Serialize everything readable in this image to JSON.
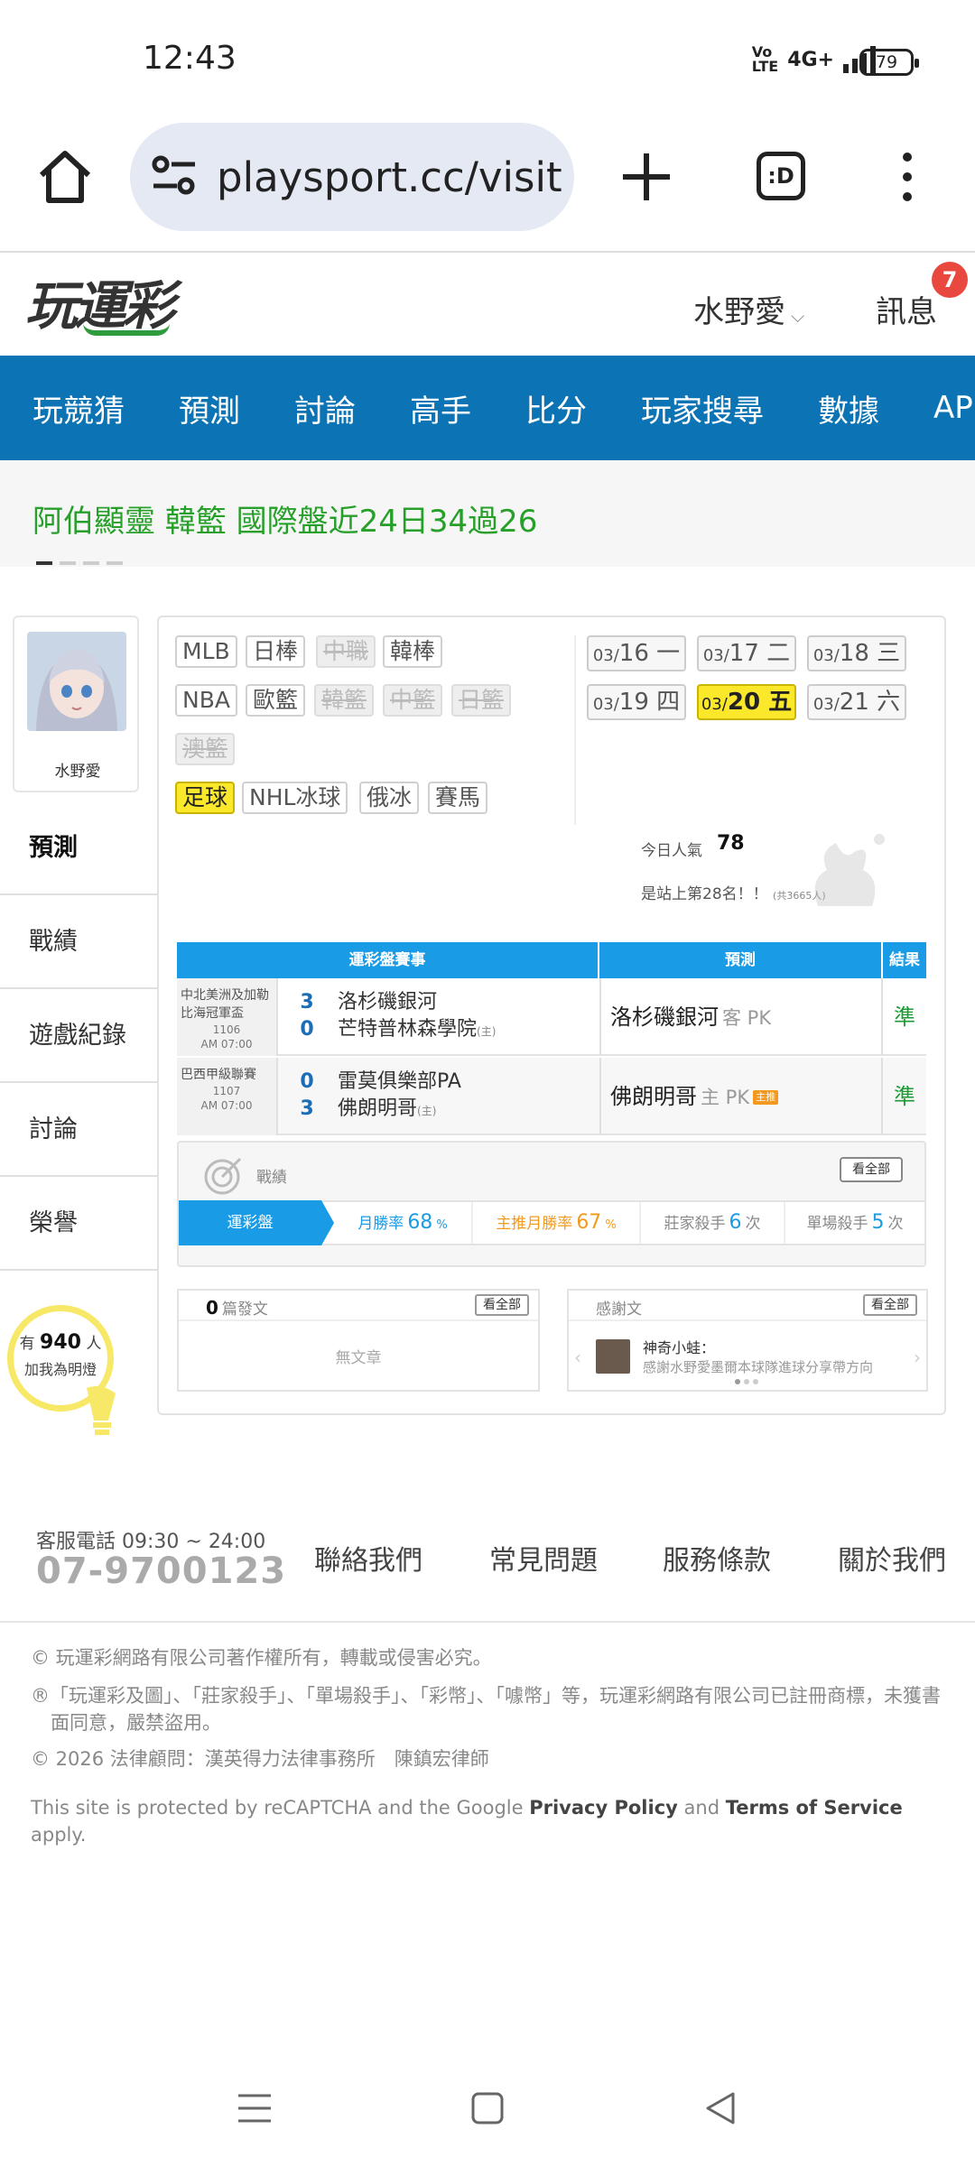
{
  "status": {
    "time": "12:43",
    "network": "4G+",
    "battery": "79"
  },
  "browser": {
    "url": "playsport.cc/visit",
    "tabs_label": ":D"
  },
  "header": {
    "logo": "玩運彩",
    "user": "水野愛",
    "messages_label": "訊息",
    "messages_count": "7"
  },
  "nav": [
    "玩競猜",
    "預測",
    "討論",
    "高手",
    "比分",
    "玩家搜尋",
    "數據",
    "APP"
  ],
  "ticker": {
    "text": "阿伯顯靈 韓籃 國際盤近24日34過26"
  },
  "profile": {
    "name": "水野愛"
  },
  "sidemenu": [
    "預測",
    "戰績",
    "遊戲紀錄",
    "討論",
    "榮譽"
  ],
  "fans": {
    "prefix": "有",
    "count": "940",
    "suffix": "人",
    "line2": "加我為明燈"
  },
  "sports": {
    "row1": [
      "MLB",
      "日棒",
      "中職",
      "韓棒"
    ],
    "row2": [
      "NBA",
      "歐籃",
      "韓籃",
      "中籃",
      "日籃"
    ],
    "row3": [
      "澳籃"
    ],
    "row4": [
      "足球",
      "NHL冰球",
      "俄冰",
      "賽馬"
    ]
  },
  "dates": [
    {
      "m": "03/",
      "d": "16 一"
    },
    {
      "m": "03/",
      "d": "17 二"
    },
    {
      "m": "03/",
      "d": "18 三"
    },
    {
      "m": "03/",
      "d": "19 四"
    },
    {
      "m": "03/",
      "d": "20 五"
    },
    {
      "m": "03/",
      "d": "21 六"
    }
  ],
  "popularity": {
    "label": "今日人氣",
    "value": "78",
    "rank": "是站上第28名！！",
    "total": "(共3665人)"
  },
  "table": {
    "headers": [
      "運彩盤賽事",
      "預測",
      "結果"
    ],
    "rows": [
      {
        "league": "中北美洲及加勒比海冠軍盃",
        "id": "1106",
        "time": "AM 07:00",
        "s1": "3",
        "s2": "0",
        "t1": "洛杉磯銀河",
        "t2": "芒特普林森學院",
        "t2tag": "(主)",
        "pick": "洛杉磯銀河",
        "side": "客 PK",
        "tag": "",
        "result": "準"
      },
      {
        "league": "巴西甲級聯賽",
        "id": "1107",
        "time": "AM 07:00",
        "s1": "0",
        "s2": "3",
        "t1": "雷莫俱樂部PA",
        "t2": "佛朗明哥",
        "t2tag": "(主)",
        "pick": "佛朗明哥",
        "side": "主 PK",
        "tag": "主推",
        "result": "準"
      }
    ]
  },
  "record": {
    "label": "戰績",
    "all": "看全部",
    "lead": "運彩盤",
    "monthly_label": "月勝率",
    "monthly": "68",
    "monthly_unit": "%",
    "main_label": "主推月勝率",
    "main": "67",
    "main_unit": "%",
    "killer_label": "莊家殺手",
    "killer": "6",
    "killer_unit": "次",
    "single_label": "單場殺手",
    "single": "5",
    "single_unit": "次"
  },
  "posts": {
    "count": "0",
    "label": "篇發文",
    "all": "看全部",
    "empty": "無文章"
  },
  "thanks": {
    "label": "感謝文",
    "all": "看全部",
    "name": "神奇小蛙：",
    "msg": "感謝水野愛墨爾本球隊進球分享帶方向"
  },
  "footer": {
    "contact": "客服電話 09:30 ~ 24:00",
    "phone": "07-9700123",
    "links": [
      "聯絡我們",
      "常見問題",
      "服務條款",
      "關於我們"
    ],
    "legal1": "© 玩運彩網路有限公司著作權所有，轉載或侵害必究。",
    "legal2": "®「玩運彩及圖」、「莊家殺手」、「單場殺手」、「彩幣」、「噱幣」等，玩運彩網路有限公司已註冊商標，未獲書面同意，嚴禁盜用。",
    "legal3": "© 2026 法律顧問：漢英得力法律事務所　陳鎮宏律師",
    "recaptcha_pre": "This site is protected by reCAPTCHA and the Google",
    "privacy": "Privacy Policy",
    "and": "and",
    "terms": "Terms of Service",
    "apply": "apply."
  }
}
